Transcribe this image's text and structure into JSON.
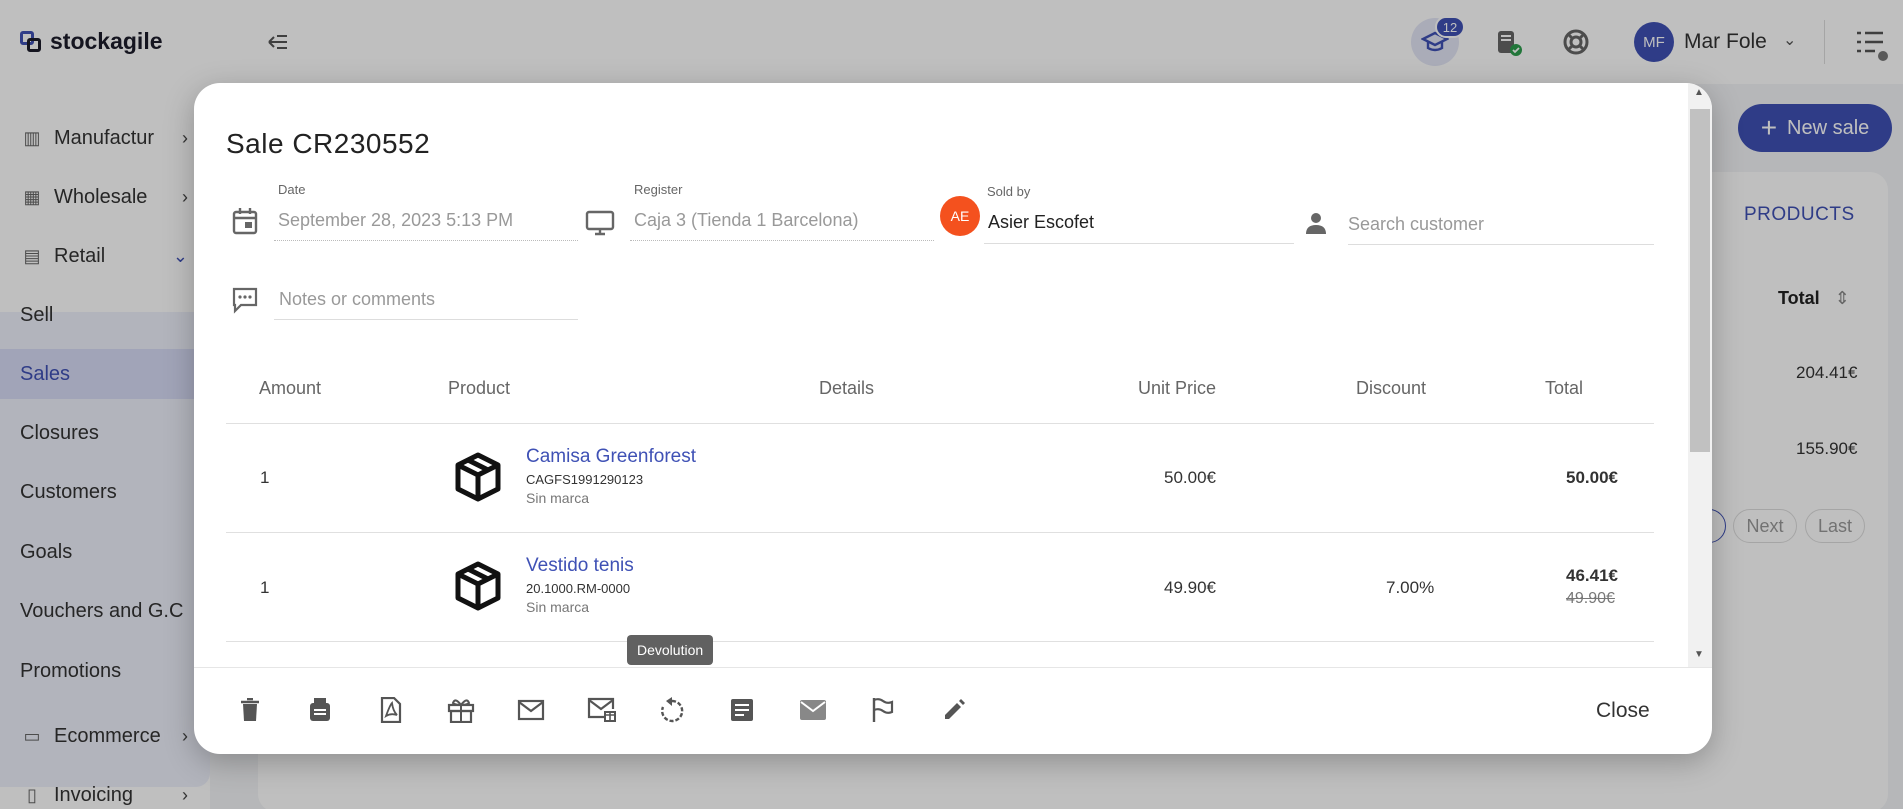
{
  "topbar": {
    "logo_text": "stockagile",
    "notifications_count": "12",
    "user_initials": "MF",
    "user_name": "Mar Fole"
  },
  "sidebar": {
    "items": [
      {
        "label": "Manufactur",
        "icon": "factory-icon"
      },
      {
        "label": "Wholesale",
        "icon": "store-icon"
      },
      {
        "label": "Retail",
        "icon": "shop-icon"
      },
      {
        "label": "Sell"
      },
      {
        "label": "Sales"
      },
      {
        "label": "Closures"
      },
      {
        "label": "Customers"
      },
      {
        "label": "Goals"
      },
      {
        "label": "Vouchers and G.C"
      },
      {
        "label": "Promotions"
      },
      {
        "label": "Ecommerce",
        "icon": "laptop-icon"
      },
      {
        "label": "Invoicing",
        "icon": "document-icon"
      }
    ]
  },
  "page": {
    "new_sale_label": "New sale",
    "products_tab": "PRODUCTS",
    "total_header": "Total",
    "row_totals": [
      "204.41€",
      "155.90€"
    ],
    "pager_next": "Next",
    "pager_last": "Last"
  },
  "modal": {
    "title": "Sale CR230552",
    "date_label": "Date",
    "date_value": "September 28, 2023 5:13 PM",
    "register_label": "Register",
    "register_value": "Caja 3 (Tienda 1 Barcelona)",
    "seller_initials": "AE",
    "sold_by_label": "Sold by",
    "sold_by_value": "Asier Escofet",
    "customer_placeholder": "Search customer",
    "notes_placeholder": "Notes or comments",
    "table": {
      "headers": [
        "Amount",
        "Product",
        "Details",
        "Unit Price",
        "Discount",
        "Total"
      ],
      "rows": [
        {
          "amount": "1",
          "name": "Camisa Greenforest",
          "code": "CAGFS1991290123",
          "brand": "Sin marca",
          "unit_price": "50.00€",
          "discount": "",
          "total": "50.00€",
          "original_total": ""
        },
        {
          "amount": "1",
          "name": "Vestido tenis",
          "code": "20.1000.RM-0000",
          "brand": "Sin marca",
          "unit_price": "49.90€",
          "discount": "7.00%",
          "total": "46.41€",
          "original_total": "49.90€"
        }
      ]
    },
    "tooltip": "Devolution",
    "close_label": "Close"
  }
}
